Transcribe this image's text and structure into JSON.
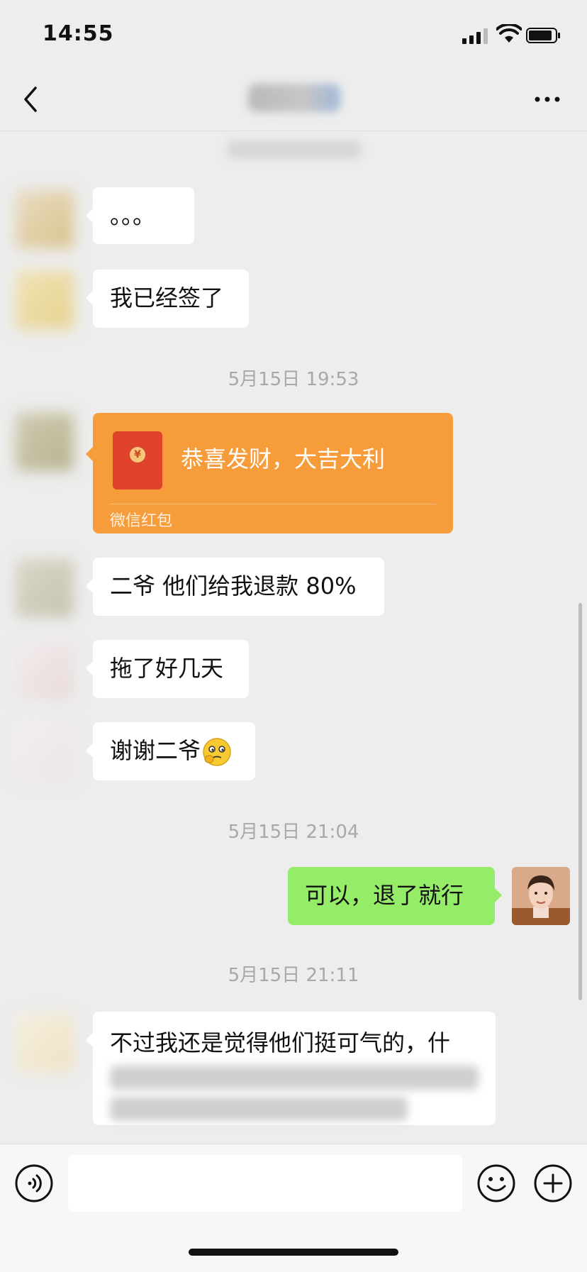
{
  "status_bar": {
    "time": "14:55"
  },
  "nav": {
    "title_blurred": ""
  },
  "messages": {
    "m1": "。。。",
    "m2": "我已经签了",
    "t1": "5月15日 19:53",
    "red_packet": {
      "title": "恭喜发财，大吉大利",
      "label": "微信红包",
      "coin": "¥"
    },
    "m3": "二爷 他们给我退款 80%",
    "m4": "拖了好几天",
    "m5": "谢谢二爷",
    "t2": "5月15日 21:04",
    "m6": "可以，退了就行",
    "t3": "5月15日 21:11",
    "m7": "不过我还是觉得他们挺可气的，什"
  },
  "input": {
    "placeholder": ""
  },
  "colors": {
    "background": "#ededed",
    "self_bubble": "#95ec69",
    "red_packet": "#f79c3a"
  },
  "icons": [
    "back-arrow-icon",
    "more-icon",
    "voice-icon",
    "emoji-icon",
    "plus-icon",
    "wifi-icon",
    "battery-icon",
    "signal-icon"
  ]
}
